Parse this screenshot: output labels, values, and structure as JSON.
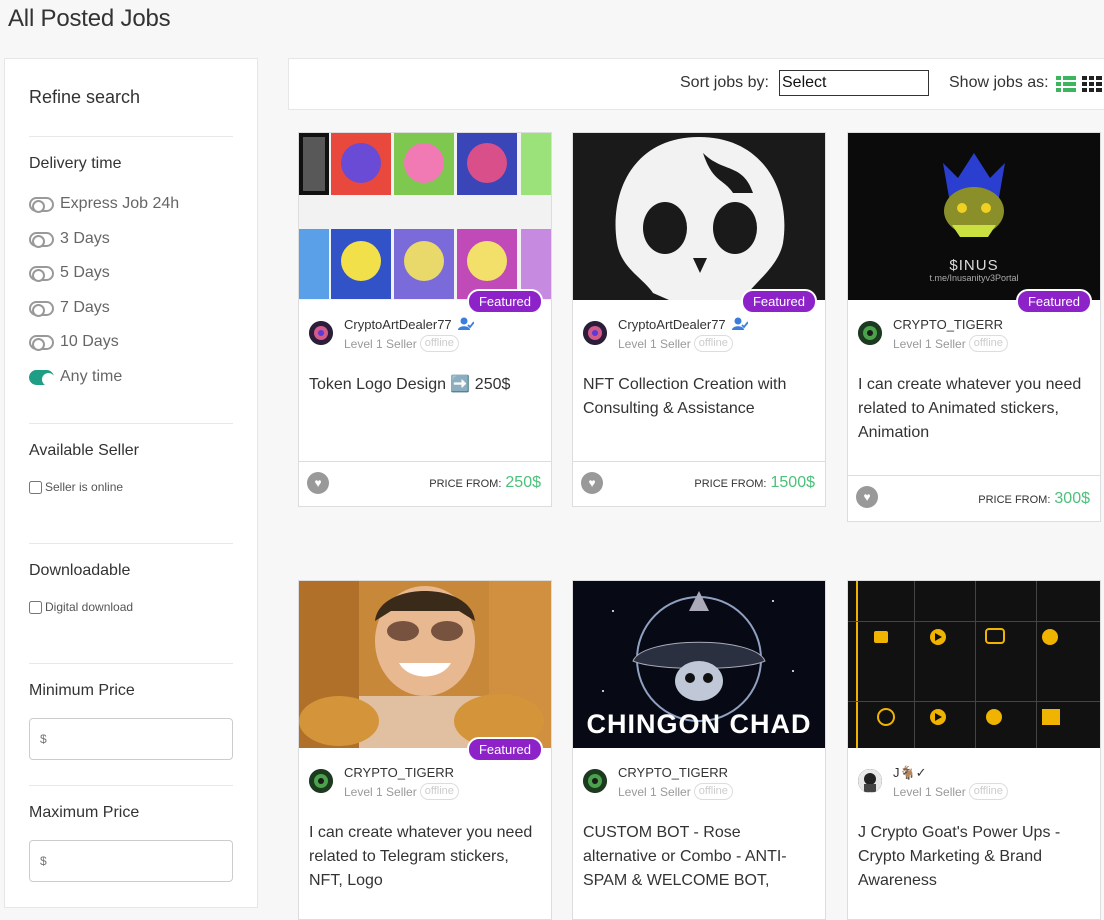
{
  "page": {
    "title": "All Posted Jobs"
  },
  "sidebar": {
    "refine": "Refine search",
    "delivery_title": "Delivery time",
    "delivery_options": [
      {
        "label": "Express Job 24h",
        "on": false
      },
      {
        "label": "3 Days",
        "on": false
      },
      {
        "label": "5 Days",
        "on": false
      },
      {
        "label": "7 Days",
        "on": false
      },
      {
        "label": "10 Days",
        "on": false
      },
      {
        "label": "Any time",
        "on": true
      }
    ],
    "available_title": "Available Seller",
    "seller_online": "Seller is online",
    "downloadable_title": "Downloadable",
    "digital_download": "Digital download",
    "min_price_title": "Minimum Price",
    "min_price_placeholder": "$",
    "max_price_title": "Maximum Price",
    "max_price_placeholder": "$"
  },
  "toolbar": {
    "sort_label": "Sort jobs by:",
    "sort_value": "Select",
    "show_label": "Show jobs as:"
  },
  "cards": [
    {
      "featured": "Featured",
      "seller": "CryptoArtDealer77",
      "level": "Level 1 Seller",
      "status": "offline",
      "title": "Token Logo Design ➡️ 250$",
      "price_from": "PRICE FROM:",
      "price": "250$",
      "verified": true
    },
    {
      "featured": "Featured",
      "seller": "CryptoArtDealer77",
      "level": "Level 1 Seller",
      "status": "offline",
      "title": "NFT Collection Creation with Consulting & Assistance",
      "price_from": "PRICE FROM:",
      "price": "1500$",
      "verified": true
    },
    {
      "featured": "Featured",
      "seller": "CRYPTO_TIGERR",
      "level": "Level 1 Seller",
      "status": "offline",
      "title": "I can create whatever you need related to Animated stickers, Animation",
      "price_from": "PRICE FROM:",
      "price": "300$",
      "verified": false,
      "thumb_text": "$INUS",
      "thumb_sub": "t.me/Inusanityv3Portal"
    },
    {
      "featured": "Featured",
      "seller": "CRYPTO_TIGERR",
      "level": "Level 1 Seller",
      "status": "offline",
      "title": "I can create whatever you need related to Telegram stickers, NFT, Logo"
    },
    {
      "seller": "CRYPTO_TIGERR",
      "level": "Level 1 Seller",
      "status": "offline",
      "title": "CUSTOM BOT - Rose alternative or Combo - ANTI-SPAM & WELCOME BOT,",
      "thumb_text": "CHINGON CHAD"
    },
    {
      "seller": "J🐐✓",
      "level": "Level 1 Seller",
      "status": "offline",
      "title": "J Crypto Goat's Power Ups - Crypto Marketing & Brand Awareness"
    }
  ],
  "colors": {
    "accent_green": "#1e9e84",
    "price_green": "#4cc17a",
    "featured_purple": "#8d22c9"
  }
}
